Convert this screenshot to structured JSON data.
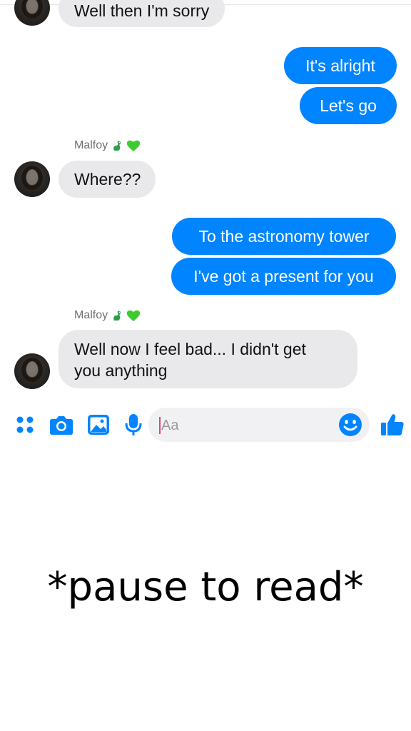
{
  "messages": {
    "m1": "Well then I'm sorry",
    "m2": "It's alright",
    "m3": "Let's go",
    "m4": "Where??",
    "m5": "To the astronomy tower",
    "m6": "I've got a present for you",
    "m7_line1": "Well now I feel bad... I didn't get",
    "m7_line2": "you anything"
  },
  "senders": {
    "group1": "Malfoy",
    "group2": "Malfoy"
  },
  "composer": {
    "placeholder": "Aa"
  },
  "icons": {
    "apps": "apps-grid-icon",
    "camera": "camera-icon",
    "gallery": "image-icon",
    "mic": "microphone-icon",
    "emoji": "smiley-icon",
    "like": "thumbs-up-icon",
    "sender_emoji": [
      "dragon-emoji-icon",
      "green-heart-emoji-icon"
    ]
  },
  "colors": {
    "outgoing_bubble": "#0084ff",
    "incoming_bubble": "#e9e9eb",
    "accent": "#0084ff"
  },
  "caption": "*pause to read*"
}
